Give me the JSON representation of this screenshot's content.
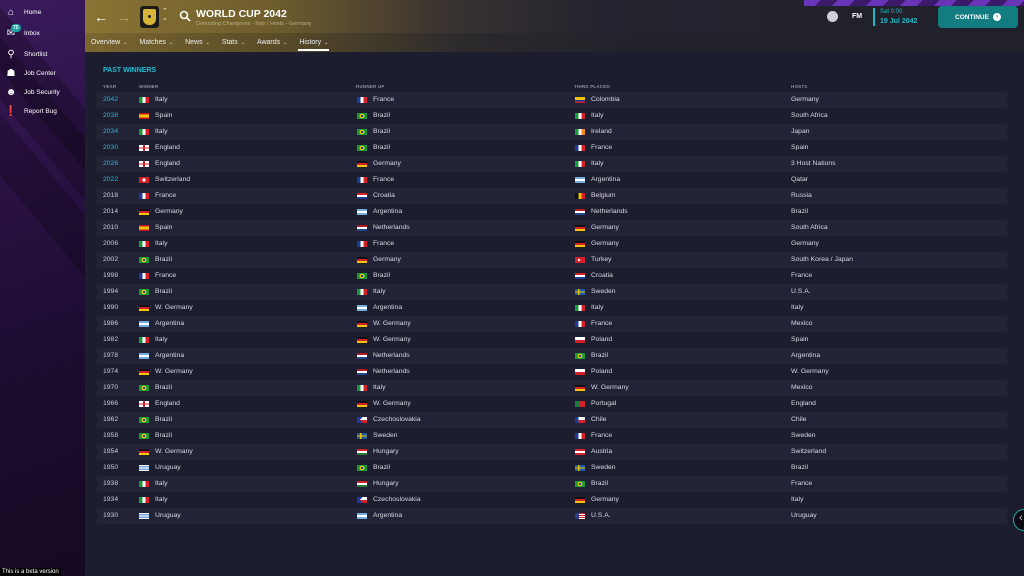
{
  "sidebar": {
    "items": [
      {
        "label": "Home",
        "icon": "home-icon"
      },
      {
        "label": "Inbox",
        "icon": "inbox-icon",
        "badge": "75"
      },
      {
        "label": "Shortlist",
        "icon": "search-icon"
      },
      {
        "label": "Job Center",
        "icon": "job-center-icon"
      },
      {
        "label": "Job Security",
        "icon": "job-security-icon"
      },
      {
        "label": "Report Bug",
        "icon": "report-bug-icon"
      }
    ],
    "beta_notice": "This is a beta version"
  },
  "header": {
    "title": "WORLD CUP 2042",
    "subtitle": "Defending Champions - Italy / Hosts - Germany",
    "tabs": [
      {
        "label": "Overview"
      },
      {
        "label": "Matches"
      },
      {
        "label": "News"
      },
      {
        "label": "Stats"
      },
      {
        "label": "Awards"
      },
      {
        "label": "History",
        "active": true
      }
    ],
    "fm_label": "FM",
    "date_time": "Sat 0:00",
    "date": "19 Jul 2042",
    "continue_label": "CONTINUE"
  },
  "section": {
    "title": "PAST WINNERS",
    "columns": [
      "YEAR",
      "WINNER",
      "RUNNER UP",
      "THIRD PLACED",
      "HOSTS"
    ]
  },
  "colors": {
    "accent": "#22bcd0",
    "continue": "#137c80"
  },
  "rows": [
    {
      "year": "2042",
      "link": true,
      "winner": "Italy",
      "runner_up": "France",
      "third": "Colombia",
      "hosts": "Germany"
    },
    {
      "year": "2038",
      "link": true,
      "winner": "Spain",
      "runner_up": "Brazil",
      "third": "Italy",
      "hosts": "South Africa"
    },
    {
      "year": "2034",
      "link": true,
      "winner": "Italy",
      "runner_up": "Brazil",
      "third": "Ireland",
      "hosts": "Japan"
    },
    {
      "year": "2030",
      "link": true,
      "winner": "England",
      "runner_up": "Brazil",
      "third": "France",
      "hosts": "Spain"
    },
    {
      "year": "2026",
      "link": true,
      "winner": "England",
      "runner_up": "Germany",
      "third": "Italy",
      "hosts": "3 Host Nations"
    },
    {
      "year": "2022",
      "link": true,
      "winner": "Switzerland",
      "runner_up": "France",
      "third": "Argentina",
      "hosts": "Qatar"
    },
    {
      "year": "2018",
      "winner": "France",
      "runner_up": "Croatia",
      "third": "Belgium",
      "hosts": "Russia"
    },
    {
      "year": "2014",
      "winner": "Germany",
      "runner_up": "Argentina",
      "third": "Netherlands",
      "hosts": "Brazil"
    },
    {
      "year": "2010",
      "winner": "Spain",
      "runner_up": "Netherlands",
      "third": "Germany",
      "hosts": "South Africa"
    },
    {
      "year": "2006",
      "winner": "Italy",
      "runner_up": "France",
      "third": "Germany",
      "hosts": "Germany"
    },
    {
      "year": "2002",
      "winner": "Brazil",
      "runner_up": "Germany",
      "third": "Turkey",
      "hosts": "South Korea / Japan"
    },
    {
      "year": "1998",
      "winner": "France",
      "runner_up": "Brazil",
      "third": "Croatia",
      "hosts": "France"
    },
    {
      "year": "1994",
      "winner": "Brazil",
      "runner_up": "Italy",
      "third": "Sweden",
      "hosts": "U.S.A."
    },
    {
      "year": "1990",
      "winner": "W. Germany",
      "runner_up": "Argentina",
      "third": "Italy",
      "hosts": "Italy"
    },
    {
      "year": "1986",
      "winner": "Argentina",
      "runner_up": "W. Germany",
      "third": "France",
      "hosts": "Mexico"
    },
    {
      "year": "1982",
      "winner": "Italy",
      "runner_up": "W. Germany",
      "third": "Poland",
      "hosts": "Spain"
    },
    {
      "year": "1978",
      "winner": "Argentina",
      "runner_up": "Netherlands",
      "third": "Brazil",
      "hosts": "Argentina"
    },
    {
      "year": "1974",
      "winner": "W. Germany",
      "runner_up": "Netherlands",
      "third": "Poland",
      "hosts": "W. Germany"
    },
    {
      "year": "1970",
      "winner": "Brazil",
      "runner_up": "Italy",
      "third": "W. Germany",
      "hosts": "Mexico"
    },
    {
      "year": "1966",
      "winner": "England",
      "runner_up": "W. Germany",
      "third": "Portugal",
      "hosts": "England"
    },
    {
      "year": "1962",
      "winner": "Brazil",
      "runner_up": "Czechoslovakia",
      "third": "Chile",
      "hosts": "Chile"
    },
    {
      "year": "1958",
      "winner": "Brazil",
      "runner_up": "Sweden",
      "third": "France",
      "hosts": "Sweden"
    },
    {
      "year": "1954",
      "winner": "W. Germany",
      "runner_up": "Hungary",
      "third": "Austria",
      "hosts": "Switzerland"
    },
    {
      "year": "1950",
      "winner": "Uruguay",
      "runner_up": "Brazil",
      "third": "Sweden",
      "hosts": "Brazil"
    },
    {
      "year": "1938",
      "winner": "Italy",
      "runner_up": "Hungary",
      "third": "Brazil",
      "hosts": "France"
    },
    {
      "year": "1934",
      "winner": "Italy",
      "runner_up": "Czechoslovakia",
      "third": "Germany",
      "hosts": "Italy"
    },
    {
      "year": "1930",
      "winner": "Uruguay",
      "runner_up": "Argentina",
      "third": "U.S.A.",
      "hosts": "Uruguay"
    }
  ]
}
